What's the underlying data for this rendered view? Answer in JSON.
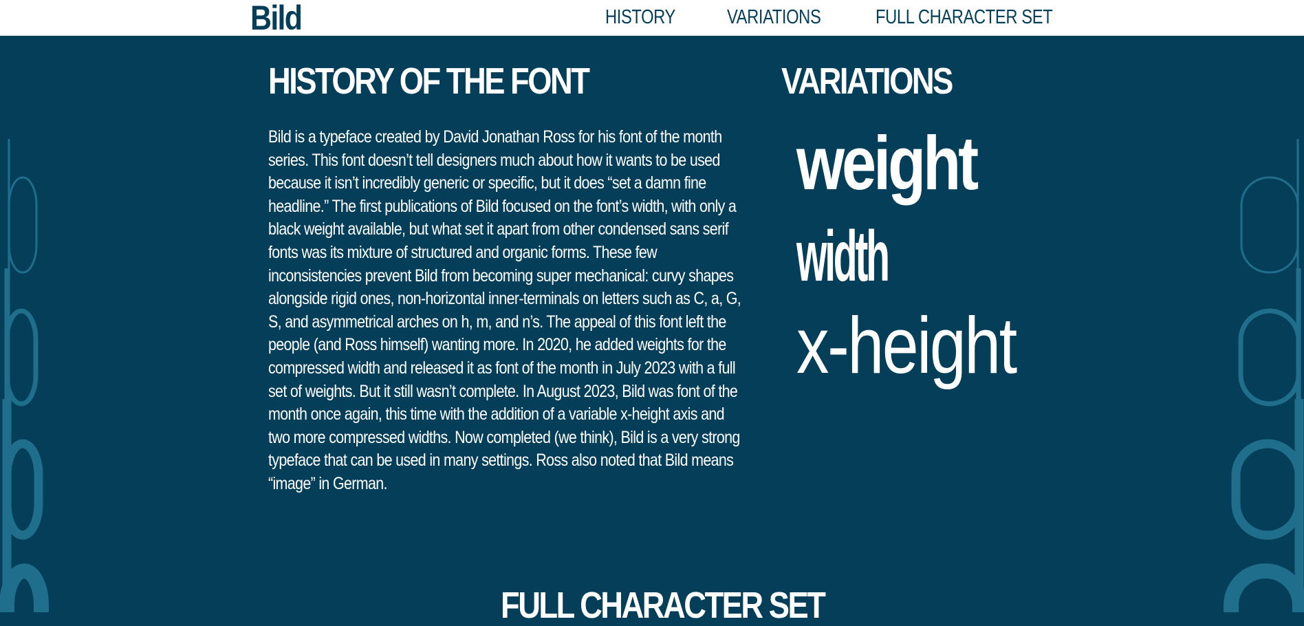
{
  "header": {
    "logo": "Bild",
    "nav": [
      "HISTORY",
      "VARIATIONS",
      "FULL CHARACTER SET"
    ]
  },
  "history": {
    "heading": "HISTORY OF THE FONT",
    "body": "Bild is a typeface created by David Jonathan Ross for his font of the month series. This font doesn’t tell designers much about how it wants to be used because it isn’t incredibly generic or specific, but it does “set a damn fine headline.” The first publications of Bild focused on the font’s width, with only a black weight available, but what set it apart from other condensed sans serif fonts was its mixture of structured and organic forms. These few inconsistencies prevent Bild from becoming super mechanical: curvy shapes alongside rigid ones, non-horizontal inner-terminals on letters such as C, a, G, S, and asymmetrical arches on h, m, and n’s. The appeal of this font left the people (and Ross himself) wanting more. In 2020, he added weights for the compressed width and released it as font of the month in July 2023 with a full set of weights. But it still wasn’t complete. In August 2023, Bild was font of the month once again, this time with the addition of a variable x-height axis and two more compressed widths. Now completed (we think), Bild is a very strong typeface that can be used in many settings. Ross also noted that Bild means “image” in German."
  },
  "variations": {
    "heading": "VARIATIONS",
    "words": [
      "weight",
      "width",
      "x-height"
    ]
  },
  "full_character_set": {
    "heading": "FULL CHARACTER SET"
  },
  "colors": {
    "background": "#043e59",
    "header_background": "#ffffff",
    "brand_text": "#043e59",
    "text": "#ffffff",
    "decoration": "#1f6e8c"
  }
}
